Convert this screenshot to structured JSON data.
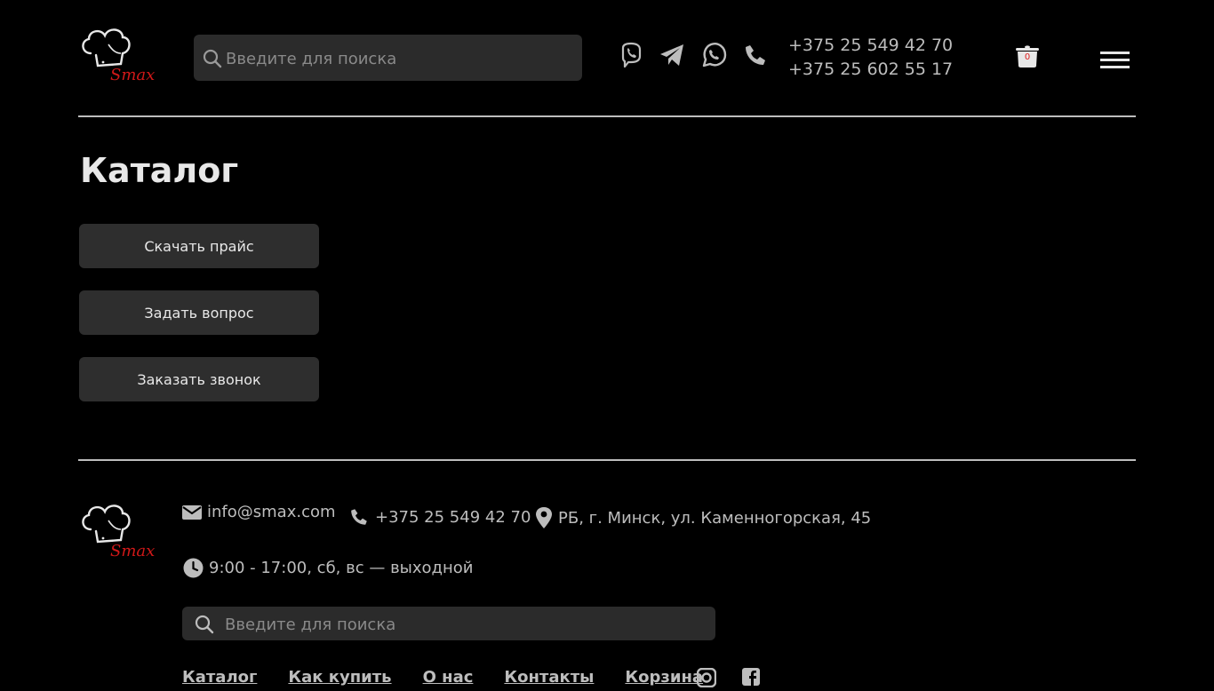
{
  "header": {
    "logo_text": "Smax",
    "search": {
      "placeholder": "Введите для поиска",
      "value": ""
    },
    "social_icons": [
      "viber-icon",
      "telegram-icon",
      "whatsapp-icon",
      "phone-icon"
    ],
    "phones": [
      "+375 25 549 42 70",
      "+375 25 602 55 17"
    ],
    "cart_count": "0"
  },
  "main": {
    "title": "Каталог",
    "buttons": [
      "Скачать прайс",
      "Задать вопрос",
      "Заказать звонок"
    ]
  },
  "footer": {
    "logo_text": "Smax",
    "email": "info@smax.com",
    "phone": "+375 25 549 42 70",
    "address": "РБ, г. Минск, ул. Каменногорская, 45",
    "hours": "9:00 - 17:00, сб, вс — выходной",
    "search": {
      "placeholder": "Введите для поиска",
      "value": ""
    },
    "nav": [
      "Каталог",
      "Как купить",
      "О нас",
      "Контакты",
      "Корзина"
    ],
    "social_icons": [
      "instagram-icon",
      "facebook-icon"
    ]
  },
  "colors": {
    "background": "#000000",
    "panel": "#2b2b2b",
    "accent_red": "#e02020",
    "text": "#bdbdbd"
  }
}
